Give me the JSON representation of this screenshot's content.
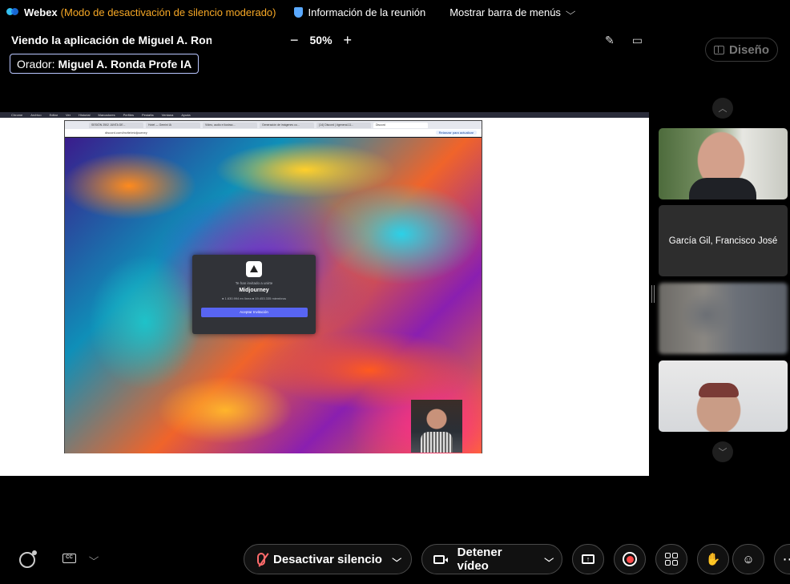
{
  "topbar": {
    "app_name": "Webex",
    "mode": "(Modo de desactivación de silencio moderado)",
    "meeting_info": "Información de la reunión",
    "menu_toggle": "Mostrar barra de menús"
  },
  "share": {
    "title": "Viendo la aplicación de Miguel A. Ron...",
    "zoom_minus": "−",
    "zoom_level": "50%",
    "zoom_plus": "+",
    "speaker_label": "Orador:",
    "speaker_name": "Miguel A. Ronda Profe IA"
  },
  "shared_screen": {
    "mac_menu": [
      "Chrome",
      "Archivo",
      "Editar",
      "Ver",
      "Historial",
      "Marcadores",
      "Perfiles",
      "Pestaña",
      "Ventana",
      "Ayuda"
    ],
    "tabs": [
      "SESIÓN 2502 JUNTA DE...",
      "Hotel — Gemini IA",
      "Vídeo, audio e ilustrac...",
      "Generación de imágenes co...",
      "(14) Discord | #general-11...",
      "Discord"
    ],
    "url": "discord.com/invite/midjourney",
    "update_label": "Relanzar para actualizar",
    "invite_sub": "Te han invitado a unirte",
    "invite_name": "Midjourney",
    "invite_stats": "● 1.630.994 en línea   ● 19.453.335 miembros",
    "invite_button": "Aceptar Invitación"
  },
  "panel": {
    "layout_label": "Diseño",
    "participant_2": "García Gil, Francisco José"
  },
  "toolbar": {
    "mute_label": "Desactivar silencio",
    "video_label": "Detener vídeo",
    "cc_label": "CC"
  },
  "colors": {
    "mode_text": "#f7a825",
    "invite_button": "#5865f2",
    "muted_mic": "#ff6b6b",
    "record": "#ff4a4a"
  }
}
